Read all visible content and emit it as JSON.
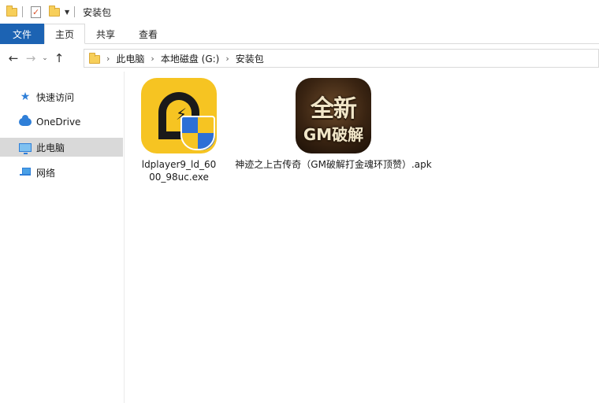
{
  "window": {
    "title": "安装包"
  },
  "ribbon": {
    "tabs": [
      {
        "label": "文件"
      },
      {
        "label": "主页"
      },
      {
        "label": "共享"
      },
      {
        "label": "查看"
      }
    ],
    "active": "主页"
  },
  "nav": {
    "back": "←",
    "forward": "→",
    "recent": "⌄",
    "up": "↑"
  },
  "address": {
    "crumbs": [
      "此电脑",
      "本地磁盘 (G:)",
      "安装包"
    ],
    "separator": "›"
  },
  "sidebar": {
    "items": [
      {
        "label": "快速访问",
        "icon": "star-icon"
      },
      {
        "label": "OneDrive",
        "icon": "cloud-icon"
      },
      {
        "label": "此电脑",
        "icon": "computer-icon",
        "selected": true
      },
      {
        "label": "网络",
        "icon": "network-icon"
      }
    ]
  },
  "files": [
    {
      "name": "ldplayer9_ld_6000_98uc.exe",
      "icon": "ldplayer-icon"
    },
    {
      "name": "神迹之上古传奇（GM破解打金魂环顶赞）.apk",
      "icon": "apk-game-icon",
      "icon_text_1": "全新",
      "icon_text_2": "GM破解"
    }
  ],
  "colors": {
    "accent": "#1c63b3",
    "selection": "#d9d9d9",
    "folder": "#f7cf5a"
  }
}
